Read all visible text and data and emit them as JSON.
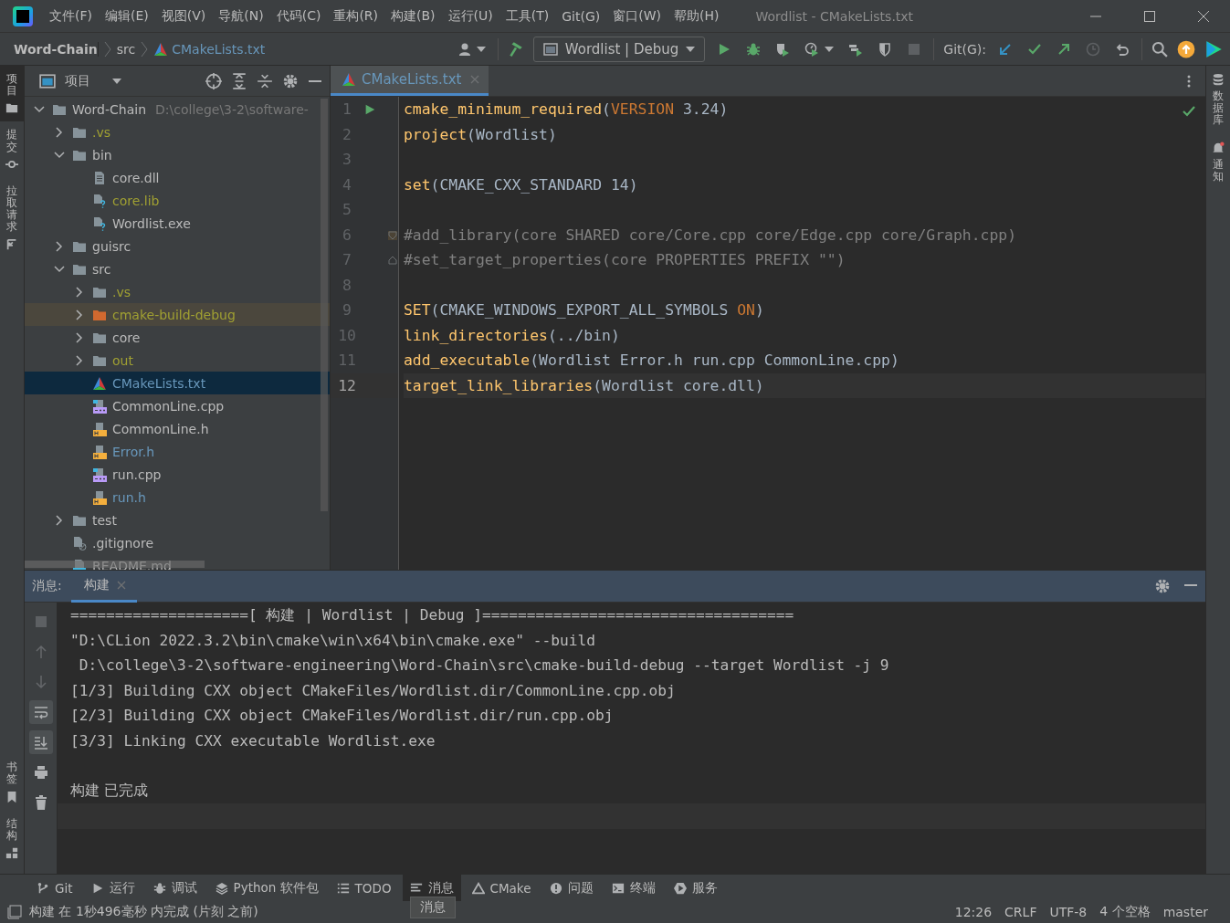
{
  "menu": [
    "文件(F)",
    "编辑(E)",
    "视图(V)",
    "导航(N)",
    "代码(C)",
    "重构(R)",
    "构建(B)",
    "运行(U)",
    "工具(T)",
    "Git(G)",
    "窗口(W)",
    "帮助(H)"
  ],
  "window": {
    "title": "Wordlist - CMakeLists.txt"
  },
  "breadcrumbs": [
    {
      "label": "Word-Chain",
      "kind": "project"
    },
    {
      "label": "src",
      "kind": "folder"
    },
    {
      "label": "CMakeLists.txt",
      "kind": "cmake"
    }
  ],
  "toolbar": {
    "config": "Wordlist | Debug",
    "run_tools": [
      {
        "kind": "run",
        "disabled": false
      },
      {
        "kind": "debug",
        "disabled": false
      },
      {
        "kind": "coverage",
        "disabled": false
      },
      {
        "kind": "profile",
        "disabled": false
      },
      {
        "kind": "attach",
        "disabled": false
      },
      {
        "kind": "shield",
        "disabled": false
      },
      {
        "kind": "stop",
        "disabled": true
      }
    ],
    "git_label": "Git(G):",
    "git_tools": [
      {
        "kind": "update",
        "disabled": false
      },
      {
        "kind": "commit",
        "disabled": false
      },
      {
        "kind": "push",
        "disabled": false
      },
      {
        "kind": "history",
        "disabled": true
      },
      {
        "kind": "rollback",
        "disabled": false
      }
    ]
  },
  "left_strip_top": [
    {
      "label": "项目",
      "kind": "folder",
      "selected": true
    },
    {
      "label": "提交",
      "kind": "commit",
      "selected": false
    },
    {
      "label": "拉取请求",
      "kind": "pull",
      "selected": false
    }
  ],
  "left_strip_bottom": [
    {
      "label": "书签",
      "kind": "bookmark",
      "selected": false
    },
    {
      "label": "结构",
      "kind": "structure",
      "selected": false
    }
  ],
  "right_strip": [
    {
      "label": "数据库",
      "kind": "database"
    },
    {
      "label": "通知",
      "kind": "bell"
    }
  ],
  "project": {
    "title": "项目",
    "tree": [
      {
        "name": "Word-Chain",
        "kind": "folder",
        "color": "#bbbbbb",
        "expanded": true,
        "selected": false,
        "path": "D:\\college\\3-2\\software-",
        "children": [
          {
            "name": ".vs",
            "kind": "folder",
            "color": "#a0a032",
            "expanded": false,
            "selected": false
          },
          {
            "name": "bin",
            "kind": "folder",
            "color": "#bbbbbb",
            "expanded": true,
            "selected": false,
            "children": [
              {
                "name": "core.dll",
                "kind": "text",
                "color": "#bbbbbb",
                "selected": false
              },
              {
                "name": "core.lib",
                "kind": "unknown",
                "color": "#a0a032",
                "selected": false
              },
              {
                "name": "Wordlist.exe",
                "kind": "unknown",
                "color": "#bbbbbb",
                "selected": false
              }
            ]
          },
          {
            "name": "guisrc",
            "kind": "folder",
            "color": "#bbbbbb",
            "expanded": false,
            "selected": false
          },
          {
            "name": "src",
            "kind": "folder",
            "color": "#bbbbbb",
            "expanded": true,
            "selected": false,
            "children": [
              {
                "name": ".vs",
                "kind": "folder",
                "color": "#a0a032",
                "expanded": false,
                "selected": false
              },
              {
                "name": "cmake-build-debug",
                "kind": "excluded",
                "color": "#a0a032",
                "expanded": false,
                "selected": false
              },
              {
                "name": "core",
                "kind": "folder",
                "color": "#bbbbbb",
                "expanded": false,
                "selected": false
              },
              {
                "name": "out",
                "kind": "folder",
                "color": "#a0a032",
                "expanded": false,
                "selected": false
              },
              {
                "name": "CMakeLists.txt",
                "kind": "cmake",
                "color": "#6897bb",
                "selected": true
              },
              {
                "name": "CommonLine.cpp",
                "kind": "cpp",
                "color": "#bbbbbb",
                "selected": false
              },
              {
                "name": "CommonLine.h",
                "kind": "h",
                "color": "#bbbbbb",
                "selected": false
              },
              {
                "name": "Error.h",
                "kind": "h",
                "color": "#6897bb",
                "selected": false
              },
              {
                "name": "run.cpp",
                "kind": "cpp",
                "color": "#bbbbbb",
                "selected": false
              },
              {
                "name": "run.h",
                "kind": "h",
                "color": "#6897bb",
                "selected": false
              }
            ]
          },
          {
            "name": "test",
            "kind": "folder",
            "color": "#bbbbbb",
            "expanded": false,
            "selected": false
          },
          {
            "name": ".gitignore",
            "kind": "ignorefile",
            "color": "#bbbbbb",
            "selected": false
          },
          {
            "name": "README.md",
            "kind": "md",
            "color": "#bbbbbb",
            "selected": false
          }
        ]
      }
    ]
  },
  "editor": {
    "tab": {
      "label": "CMakeLists.txt",
      "selected": true
    },
    "lines": [
      {
        "number": "1",
        "current": false,
        "run_marker": true,
        "tokens": [
          {
            "kind": "fn",
            "text": "cmake_minimum_required"
          },
          {
            "kind": "plain",
            "text": "("
          },
          {
            "kind": "kw",
            "text": "VERSION"
          },
          {
            "kind": "plain",
            "text": " 3.24)"
          }
        ]
      },
      {
        "number": "2",
        "current": false,
        "tokens": [
          {
            "kind": "fn",
            "text": "project"
          },
          {
            "kind": "plain",
            "text": "(Wordlist)"
          }
        ]
      },
      {
        "number": "3",
        "current": false
      },
      {
        "number": "4",
        "current": false,
        "tokens": [
          {
            "kind": "fn",
            "text": "set"
          },
          {
            "kind": "plain",
            "text": "(CMAKE_CXX_STANDARD 14)"
          }
        ]
      },
      {
        "number": "5",
        "current": false
      },
      {
        "number": "6",
        "current": false,
        "fold_start": true,
        "tokens": [
          {
            "kind": "comment",
            "text": "#add_library(core SHARED core/Core.cpp core/Edge.cpp core/Graph.cpp)"
          }
        ]
      },
      {
        "number": "7",
        "current": false,
        "fold_end": true,
        "tokens": [
          {
            "kind": "comment",
            "text": "#set_target_properties(core PROPERTIES PREFIX \"\")"
          }
        ]
      },
      {
        "number": "8",
        "current": false
      },
      {
        "number": "9",
        "current": false,
        "tokens": [
          {
            "kind": "fn",
            "text": "SET"
          },
          {
            "kind": "plain",
            "text": "(CMAKE_WINDOWS_EXPORT_ALL_SYMBOLS "
          },
          {
            "kind": "kw",
            "text": "ON"
          },
          {
            "kind": "plain",
            "text": ")"
          }
        ]
      },
      {
        "number": "10",
        "current": false,
        "tokens": [
          {
            "kind": "fn",
            "text": "link_directories"
          },
          {
            "kind": "plain",
            "text": "(../bin)"
          }
        ]
      },
      {
        "number": "11",
        "current": false,
        "tokens": [
          {
            "kind": "fn",
            "text": "add_executable"
          },
          {
            "kind": "plain",
            "text": "(Wordlist Error.h run.cpp CommonLine.cpp)"
          }
        ]
      },
      {
        "number": "12",
        "current": true,
        "tokens": [
          {
            "kind": "fn",
            "text": "target_link_libraries"
          },
          {
            "kind": "plain",
            "text": "(Wordlist core.dll)"
          }
        ]
      }
    ]
  },
  "messages": {
    "label": "消息:",
    "tab": {
      "label": "构建",
      "selected": true
    },
    "tools": [
      {
        "kind": "stop",
        "on": false
      },
      {
        "kind": "up",
        "on": false
      },
      {
        "kind": "down",
        "on": false
      },
      {
        "kind": "wrap",
        "on": true
      },
      {
        "kind": "scroll-end",
        "on": true
      },
      {
        "kind": "print",
        "on": false
      },
      {
        "kind": "delete",
        "on": false
      }
    ],
    "lines": [
      "====================[ 构建 | Wordlist | Debug ]===================================",
      "\"D:\\CLion 2022.3.2\\bin\\cmake\\win\\x64\\bin\\cmake.exe\" --build",
      " D:\\college\\3-2\\software-engineering\\Word-Chain\\src\\cmake-build-debug --target Wordlist -j 9",
      "[1/3] Building CXX object CMakeFiles/Wordlist.dir/CommonLine.cpp.obj",
      "[2/3] Building CXX object CMakeFiles/Wordlist.dir/run.cpp.obj",
      "[3/3] Linking CXX executable Wordlist.exe"
    ],
    "result": "构建 已完成"
  },
  "bottom_tabs": [
    {
      "label": "Git",
      "kind": "git",
      "selected": false
    },
    {
      "label": "运行",
      "kind": "run",
      "selected": false
    },
    {
      "label": "调试",
      "kind": "debug",
      "selected": false
    },
    {
      "label": "Python 软件包",
      "kind": "layers",
      "selected": false
    },
    {
      "label": "TODO",
      "kind": "list",
      "selected": false
    },
    {
      "label": "消息",
      "kind": "messages",
      "selected": true
    },
    {
      "label": "CMake",
      "kind": "cmake",
      "selected": false
    },
    {
      "label": "问题",
      "kind": "problems",
      "selected": false
    },
    {
      "label": "终端",
      "kind": "terminal",
      "selected": false
    },
    {
      "label": "服务",
      "kind": "services",
      "selected": false
    }
  ],
  "tooltip": "消息",
  "status_bar": {
    "message": "构建 在 1秒496毫秒 内完成 (片刻 之前)",
    "items": [
      "12:26",
      "CRLF",
      "UTF-8",
      "4 个空格",
      "master"
    ]
  }
}
